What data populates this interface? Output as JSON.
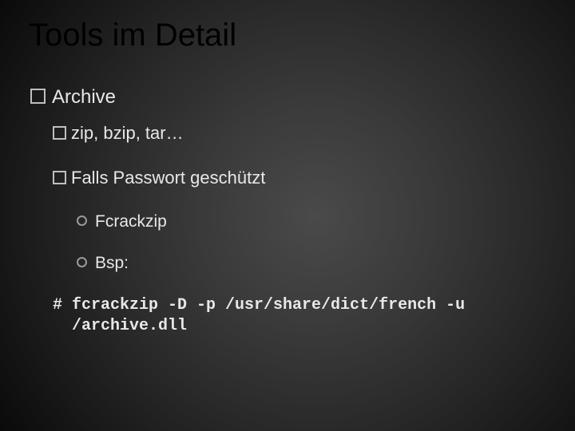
{
  "title": "Tools im Detail",
  "lvl1": {
    "label": "Archive"
  },
  "lvl2a": {
    "label": "zip, bzip, tar…"
  },
  "lvl2b": {
    "label": "Falls Passwort geschützt"
  },
  "lvl3a": {
    "label": "Fcrackzip"
  },
  "lvl3b": {
    "label": "Bsp:"
  },
  "code": "# fcrackzip -D -p /usr/share/dict/french -u\n  /archive.dll"
}
